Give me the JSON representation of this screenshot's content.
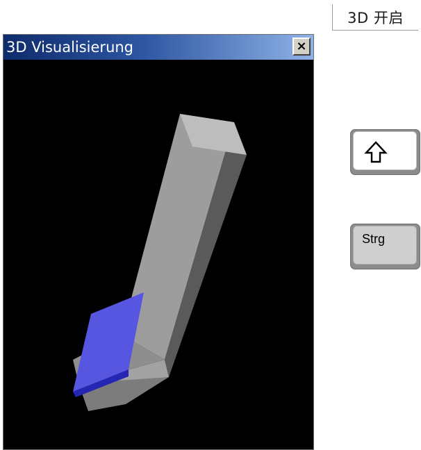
{
  "top_label": {
    "text": "3D 开启"
  },
  "window": {
    "title": "3D Visualisierung",
    "close_label": "×",
    "background_color": "#000000",
    "title_gradient": [
      "#0e2c6c",
      "#8fb2e6"
    ]
  },
  "model": {
    "body_colors": {
      "front": "#9d9d9d",
      "side": "#5a5a5a",
      "top": "#c3c3c3"
    },
    "insert_colors": {
      "face": "#5656e0",
      "edge": "#2626b4"
    }
  },
  "keys": {
    "shift": {
      "icon": "shift-arrow-icon"
    },
    "strg": {
      "label": "Strg"
    }
  }
}
